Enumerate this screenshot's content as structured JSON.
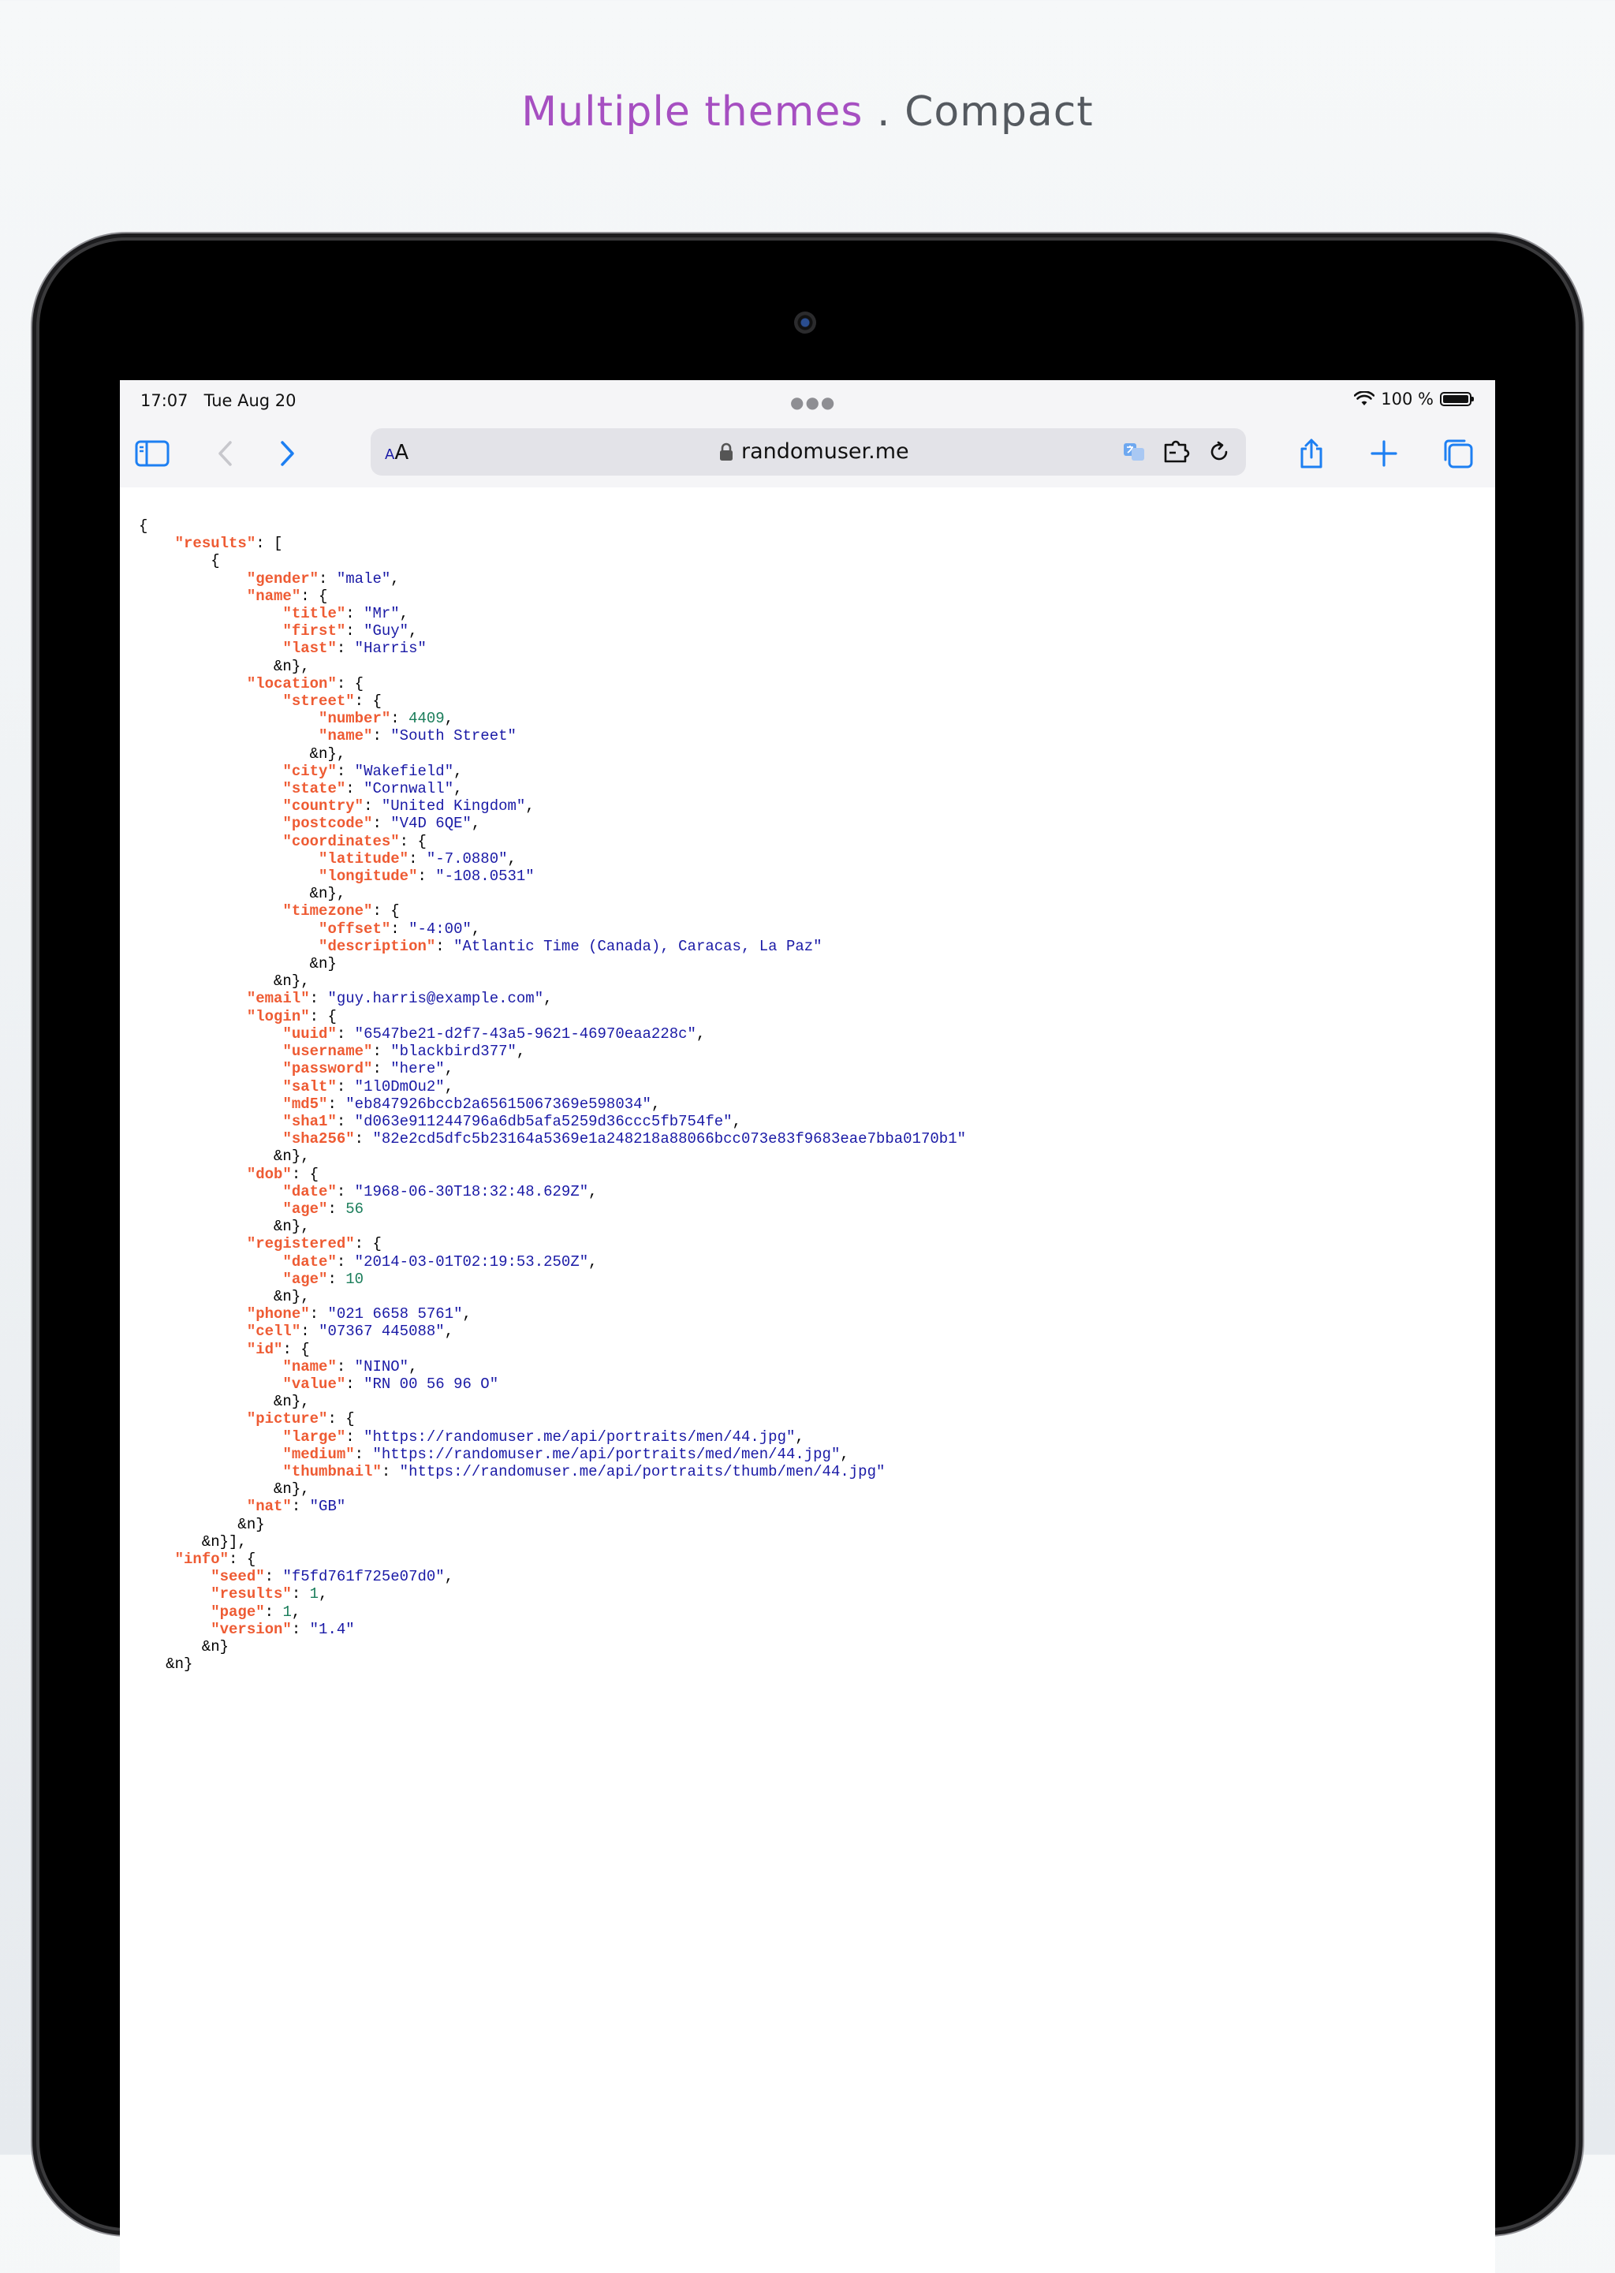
{
  "headline": {
    "accent": "Multiple themes",
    "separator": ".",
    "rest": "Compact"
  },
  "status_bar": {
    "time": "17:07",
    "date": "Tue Aug 20",
    "battery": "100 %"
  },
  "browser": {
    "text_size_label_small": "A",
    "text_size_label_large": "A",
    "host": "randomuser.me"
  },
  "icons": [
    "sidebar-icon",
    "back-icon",
    "forward-icon",
    "lock-icon",
    "translate-icon",
    "extension-icon",
    "reload-icon",
    "share-icon",
    "new-tab-icon",
    "tabs-icon",
    "wifi-icon",
    "battery-icon",
    "camera-icon"
  ],
  "colors": {
    "key": "#ee5b33",
    "string": "#1a1aa6",
    "number": "#1a7d5a",
    "accent": "#a64fc1",
    "link_blue": "#1d7ff2"
  },
  "json_lines": [
    [
      {
        "t": "p",
        "v": "{"
      }
    ],
    [
      {
        "t": "p",
        "v": "    "
      },
      {
        "t": "k",
        "v": "\"results\""
      },
      {
        "t": "p",
        "v": ": ["
      }
    ],
    [
      {
        "t": "p",
        "v": "        {"
      }
    ],
    [
      {
        "t": "p",
        "v": "            "
      },
      {
        "t": "k",
        "v": "\"gender\""
      },
      {
        "t": "p",
        "v": ": "
      },
      {
        "t": "s",
        "v": "\"male\""
      },
      {
        "t": "p",
        "v": ","
      }
    ],
    [
      {
        "t": "p",
        "v": "            "
      },
      {
        "t": "k",
        "v": "\"name\""
      },
      {
        "t": "p",
        "v": ": {"
      }
    ],
    [
      {
        "t": "p",
        "v": "                "
      },
      {
        "t": "k",
        "v": "\"title\""
      },
      {
        "t": "p",
        "v": ": "
      },
      {
        "t": "s",
        "v": "\"Mr\""
      },
      {
        "t": "p",
        "v": ","
      }
    ],
    [
      {
        "t": "p",
        "v": "                "
      },
      {
        "t": "k",
        "v": "\"first\""
      },
      {
        "t": "p",
        "v": ": "
      },
      {
        "t": "s",
        "v": "\"Guy\""
      },
      {
        "t": "p",
        "v": ","
      }
    ],
    [
      {
        "t": "p",
        "v": "                "
      },
      {
        "t": "k",
        "v": "\"last\""
      },
      {
        "t": "p",
        "v": ": "
      },
      {
        "t": "s",
        "v": "\"Harris\""
      }
    ],
    [
      {
        "t": "p",
        "v": "               &n},"
      }
    ],
    [
      {
        "t": "p",
        "v": "            "
      },
      {
        "t": "k",
        "v": "\"location\""
      },
      {
        "t": "p",
        "v": ": {"
      }
    ],
    [
      {
        "t": "p",
        "v": "                "
      },
      {
        "t": "k",
        "v": "\"street\""
      },
      {
        "t": "p",
        "v": ": {"
      }
    ],
    [
      {
        "t": "p",
        "v": "                    "
      },
      {
        "t": "k",
        "v": "\"number\""
      },
      {
        "t": "p",
        "v": ": "
      },
      {
        "t": "n",
        "v": "4409"
      },
      {
        "t": "p",
        "v": ","
      }
    ],
    [
      {
        "t": "p",
        "v": "                    "
      },
      {
        "t": "k",
        "v": "\"name\""
      },
      {
        "t": "p",
        "v": ": "
      },
      {
        "t": "s",
        "v": "\"South Street\""
      }
    ],
    [
      {
        "t": "p",
        "v": "                   &n},"
      }
    ],
    [
      {
        "t": "p",
        "v": "                "
      },
      {
        "t": "k",
        "v": "\"city\""
      },
      {
        "t": "p",
        "v": ": "
      },
      {
        "t": "s",
        "v": "\"Wakefield\""
      },
      {
        "t": "p",
        "v": ","
      }
    ],
    [
      {
        "t": "p",
        "v": "                "
      },
      {
        "t": "k",
        "v": "\"state\""
      },
      {
        "t": "p",
        "v": ": "
      },
      {
        "t": "s",
        "v": "\"Cornwall\""
      },
      {
        "t": "p",
        "v": ","
      }
    ],
    [
      {
        "t": "p",
        "v": "                "
      },
      {
        "t": "k",
        "v": "\"country\""
      },
      {
        "t": "p",
        "v": ": "
      },
      {
        "t": "s",
        "v": "\"United Kingdom\""
      },
      {
        "t": "p",
        "v": ","
      }
    ],
    [
      {
        "t": "p",
        "v": "                "
      },
      {
        "t": "k",
        "v": "\"postcode\""
      },
      {
        "t": "p",
        "v": ": "
      },
      {
        "t": "s",
        "v": "\"V4D 6QE\""
      },
      {
        "t": "p",
        "v": ","
      }
    ],
    [
      {
        "t": "p",
        "v": "                "
      },
      {
        "t": "k",
        "v": "\"coordinates\""
      },
      {
        "t": "p",
        "v": ": {"
      }
    ],
    [
      {
        "t": "p",
        "v": "                    "
      },
      {
        "t": "k",
        "v": "\"latitude\""
      },
      {
        "t": "p",
        "v": ": "
      },
      {
        "t": "s",
        "v": "\"-7.0880\""
      },
      {
        "t": "p",
        "v": ","
      }
    ],
    [
      {
        "t": "p",
        "v": "                    "
      },
      {
        "t": "k",
        "v": "\"longitude\""
      },
      {
        "t": "p",
        "v": ": "
      },
      {
        "t": "s",
        "v": "\"-108.0531\""
      }
    ],
    [
      {
        "t": "p",
        "v": "                   &n},"
      }
    ],
    [
      {
        "t": "p",
        "v": "                "
      },
      {
        "t": "k",
        "v": "\"timezone\""
      },
      {
        "t": "p",
        "v": ": {"
      }
    ],
    [
      {
        "t": "p",
        "v": "                    "
      },
      {
        "t": "k",
        "v": "\"offset\""
      },
      {
        "t": "p",
        "v": ": "
      },
      {
        "t": "s",
        "v": "\"-4:00\""
      },
      {
        "t": "p",
        "v": ","
      }
    ],
    [
      {
        "t": "p",
        "v": "                    "
      },
      {
        "t": "k",
        "v": "\"description\""
      },
      {
        "t": "p",
        "v": ": "
      },
      {
        "t": "s",
        "v": "\"Atlantic Time (Canada), Caracas, La Paz\""
      }
    ],
    [
      {
        "t": "p",
        "v": "                   &n}"
      }
    ],
    [
      {
        "t": "p",
        "v": "               &n},"
      }
    ],
    [
      {
        "t": "p",
        "v": "            "
      },
      {
        "t": "k",
        "v": "\"email\""
      },
      {
        "t": "p",
        "v": ": "
      },
      {
        "t": "s",
        "v": "\"guy.harris@example.com\""
      },
      {
        "t": "p",
        "v": ","
      }
    ],
    [
      {
        "t": "p",
        "v": "            "
      },
      {
        "t": "k",
        "v": "\"login\""
      },
      {
        "t": "p",
        "v": ": {"
      }
    ],
    [
      {
        "t": "p",
        "v": "                "
      },
      {
        "t": "k",
        "v": "\"uuid\""
      },
      {
        "t": "p",
        "v": ": "
      },
      {
        "t": "s",
        "v": "\"6547be21-d2f7-43a5-9621-46970eaa228c\""
      },
      {
        "t": "p",
        "v": ","
      }
    ],
    [
      {
        "t": "p",
        "v": "                "
      },
      {
        "t": "k",
        "v": "\"username\""
      },
      {
        "t": "p",
        "v": ": "
      },
      {
        "t": "s",
        "v": "\"blackbird377\""
      },
      {
        "t": "p",
        "v": ","
      }
    ],
    [
      {
        "t": "p",
        "v": "                "
      },
      {
        "t": "k",
        "v": "\"password\""
      },
      {
        "t": "p",
        "v": ": "
      },
      {
        "t": "s",
        "v": "\"here\""
      },
      {
        "t": "p",
        "v": ","
      }
    ],
    [
      {
        "t": "p",
        "v": "                "
      },
      {
        "t": "k",
        "v": "\"salt\""
      },
      {
        "t": "p",
        "v": ": "
      },
      {
        "t": "s",
        "v": "\"1l0DmOu2\""
      },
      {
        "t": "p",
        "v": ","
      }
    ],
    [
      {
        "t": "p",
        "v": "                "
      },
      {
        "t": "k",
        "v": "\"md5\""
      },
      {
        "t": "p",
        "v": ": "
      },
      {
        "t": "s",
        "v": "\"eb847926bccb2a65615067369e598034\""
      },
      {
        "t": "p",
        "v": ","
      }
    ],
    [
      {
        "t": "p",
        "v": "                "
      },
      {
        "t": "k",
        "v": "\"sha1\""
      },
      {
        "t": "p",
        "v": ": "
      },
      {
        "t": "s",
        "v": "\"d063e911244796a6db5afa5259d36ccc5fb754fe\""
      },
      {
        "t": "p",
        "v": ","
      }
    ],
    [
      {
        "t": "p",
        "v": "                "
      },
      {
        "t": "k",
        "v": "\"sha256\""
      },
      {
        "t": "p",
        "v": ": "
      },
      {
        "t": "s",
        "v": "\"82e2cd5dfc5b23164a5369e1a248218a88066bcc073e83f9683eae7bba0170b1\""
      }
    ],
    [
      {
        "t": "p",
        "v": "               &n},"
      }
    ],
    [
      {
        "t": "p",
        "v": "            "
      },
      {
        "t": "k",
        "v": "\"dob\""
      },
      {
        "t": "p",
        "v": ": {"
      }
    ],
    [
      {
        "t": "p",
        "v": "                "
      },
      {
        "t": "k",
        "v": "\"date\""
      },
      {
        "t": "p",
        "v": ": "
      },
      {
        "t": "s",
        "v": "\"1968-06-30T18:32:48.629Z\""
      },
      {
        "t": "p",
        "v": ","
      }
    ],
    [
      {
        "t": "p",
        "v": "                "
      },
      {
        "t": "k",
        "v": "\"age\""
      },
      {
        "t": "p",
        "v": ": "
      },
      {
        "t": "n",
        "v": "56"
      }
    ],
    [
      {
        "t": "p",
        "v": "               &n},"
      }
    ],
    [
      {
        "t": "p",
        "v": "            "
      },
      {
        "t": "k",
        "v": "\"registered\""
      },
      {
        "t": "p",
        "v": ": {"
      }
    ],
    [
      {
        "t": "p",
        "v": "                "
      },
      {
        "t": "k",
        "v": "\"date\""
      },
      {
        "t": "p",
        "v": ": "
      },
      {
        "t": "s",
        "v": "\"2014-03-01T02:19:53.250Z\""
      },
      {
        "t": "p",
        "v": ","
      }
    ],
    [
      {
        "t": "p",
        "v": "                "
      },
      {
        "t": "k",
        "v": "\"age\""
      },
      {
        "t": "p",
        "v": ": "
      },
      {
        "t": "n",
        "v": "10"
      }
    ],
    [
      {
        "t": "p",
        "v": "               &n},"
      }
    ],
    [
      {
        "t": "p",
        "v": "            "
      },
      {
        "t": "k",
        "v": "\"phone\""
      },
      {
        "t": "p",
        "v": ": "
      },
      {
        "t": "s",
        "v": "\"021 6658 5761\""
      },
      {
        "t": "p",
        "v": ","
      }
    ],
    [
      {
        "t": "p",
        "v": "            "
      },
      {
        "t": "k",
        "v": "\"cell\""
      },
      {
        "t": "p",
        "v": ": "
      },
      {
        "t": "s",
        "v": "\"07367 445088\""
      },
      {
        "t": "p",
        "v": ","
      }
    ],
    [
      {
        "t": "p",
        "v": "            "
      },
      {
        "t": "k",
        "v": "\"id\""
      },
      {
        "t": "p",
        "v": ": {"
      }
    ],
    [
      {
        "t": "p",
        "v": "                "
      },
      {
        "t": "k",
        "v": "\"name\""
      },
      {
        "t": "p",
        "v": ": "
      },
      {
        "t": "s",
        "v": "\"NINO\""
      },
      {
        "t": "p",
        "v": ","
      }
    ],
    [
      {
        "t": "p",
        "v": "                "
      },
      {
        "t": "k",
        "v": "\"value\""
      },
      {
        "t": "p",
        "v": ": "
      },
      {
        "t": "s",
        "v": "\"RN 00 56 96 O\""
      }
    ],
    [
      {
        "t": "p",
        "v": "               &n},"
      }
    ],
    [
      {
        "t": "p",
        "v": "            "
      },
      {
        "t": "k",
        "v": "\"picture\""
      },
      {
        "t": "p",
        "v": ": {"
      }
    ],
    [
      {
        "t": "p",
        "v": "                "
      },
      {
        "t": "k",
        "v": "\"large\""
      },
      {
        "t": "p",
        "v": ": "
      },
      {
        "t": "s",
        "v": "\"https://randomuser.me/api/portraits/men/44.jpg\""
      },
      {
        "t": "p",
        "v": ","
      }
    ],
    [
      {
        "t": "p",
        "v": "                "
      },
      {
        "t": "k",
        "v": "\"medium\""
      },
      {
        "t": "p",
        "v": ": "
      },
      {
        "t": "s",
        "v": "\"https://randomuser.me/api/portraits/med/men/44.jpg\""
      },
      {
        "t": "p",
        "v": ","
      }
    ],
    [
      {
        "t": "p",
        "v": "                "
      },
      {
        "t": "k",
        "v": "\"thumbnail\""
      },
      {
        "t": "p",
        "v": ": "
      },
      {
        "t": "s",
        "v": "\"https://randomuser.me/api/portraits/thumb/men/44.jpg\""
      }
    ],
    [
      {
        "t": "p",
        "v": "               &n},"
      }
    ],
    [
      {
        "t": "p",
        "v": "            "
      },
      {
        "t": "k",
        "v": "\"nat\""
      },
      {
        "t": "p",
        "v": ": "
      },
      {
        "t": "s",
        "v": "\"GB\""
      }
    ],
    [
      {
        "t": "p",
        "v": "           &n}"
      }
    ],
    [
      {
        "t": "p",
        "v": "       &n}],"
      }
    ],
    [
      {
        "t": "p",
        "v": "    "
      },
      {
        "t": "k",
        "v": "\"info\""
      },
      {
        "t": "p",
        "v": ": {"
      }
    ],
    [
      {
        "t": "p",
        "v": "        "
      },
      {
        "t": "k",
        "v": "\"seed\""
      },
      {
        "t": "p",
        "v": ": "
      },
      {
        "t": "s",
        "v": "\"f5fd761f725e07d0\""
      },
      {
        "t": "p",
        "v": ","
      }
    ],
    [
      {
        "t": "p",
        "v": "        "
      },
      {
        "t": "k",
        "v": "\"results\""
      },
      {
        "t": "p",
        "v": ": "
      },
      {
        "t": "n",
        "v": "1"
      },
      {
        "t": "p",
        "v": ","
      }
    ],
    [
      {
        "t": "p",
        "v": "        "
      },
      {
        "t": "k",
        "v": "\"page\""
      },
      {
        "t": "p",
        "v": ": "
      },
      {
        "t": "n",
        "v": "1"
      },
      {
        "t": "p",
        "v": ","
      }
    ],
    [
      {
        "t": "p",
        "v": "        "
      },
      {
        "t": "k",
        "v": "\"version\""
      },
      {
        "t": "p",
        "v": ": "
      },
      {
        "t": "s",
        "v": "\"1.4\""
      }
    ],
    [
      {
        "t": "p",
        "v": "       &n}"
      }
    ],
    [
      {
        "t": "p",
        "v": "   &n}"
      }
    ]
  ]
}
